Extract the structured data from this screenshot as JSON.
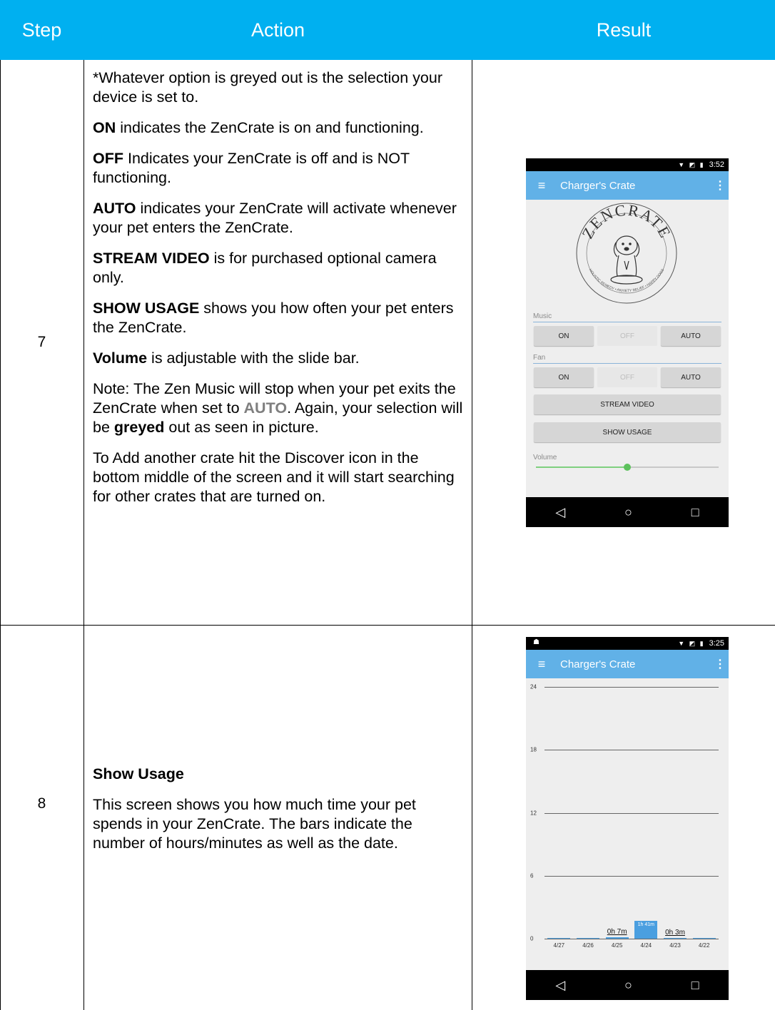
{
  "headers": {
    "step": "Step",
    "action": "Action",
    "result": "Result"
  },
  "row7": {
    "step": "7",
    "intro": "*Whatever option is greyed out is the selection your device is set to.",
    "on_term": "ON",
    "on_text": " indicates the ZenCrate is on and functioning.",
    "off_term": "OFF",
    "off_text": " Indicates your ZenCrate is off and is NOT functioning.",
    "auto_term": "AUTO",
    "auto_text": " indicates your ZenCrate will activate whenever your pet enters the ZenCrate.",
    "stream_term": "STREAM VIDEO",
    "stream_text": " is for purchased optional camera only.",
    "usage_term": "SHOW USAGE",
    "usage_text": " shows you how often your pet enters the ZenCrate.",
    "volume_term": "Volume",
    "volume_text": " is adjustable with the slide bar.",
    "note_a": "Note:  The Zen Music will stop when your pet exits the ZenCrate when set to ",
    "note_auto": "AUTO",
    "note_b": ". Again, your selection will be ",
    "note_greyed": "greyed",
    "note_c": " out as seen in picture.",
    "add_crate": "To Add another crate hit the Discover icon in the bottom middle of the screen and it will start searching for other crates that are turned on."
  },
  "row8": {
    "step": "8",
    "title": "Show Usage",
    "text": "This screen shows you how much time your pet spends in your ZenCrate.  The bars indicate the number of hours/minutes as well as the date."
  },
  "phone1": {
    "time": "3:52",
    "title": "Charger's Crate",
    "logo_text": "ZENCRATE",
    "logo_ring_text": "HOLISTIC REMEDY • ANXIETY RELIEF • HAPPY DOGS",
    "music_label": "Music",
    "fan_label": "Fan",
    "on": "ON",
    "off": "OFF",
    "auto": "AUTO",
    "music_selected": "OFF",
    "fan_selected": "OFF",
    "stream_video": "STREAM VIDEO",
    "show_usage": "SHOW USAGE",
    "volume_label": "Volume",
    "volume_level": 0.5,
    "nav_back": "◁",
    "nav_home": "○",
    "nav_recent": "□"
  },
  "phone2": {
    "time": "3:25",
    "title": "Charger's Crate",
    "nav_back": "◁",
    "nav_home": "○",
    "nav_recent": "□"
  },
  "chart_data": {
    "type": "bar",
    "categories": [
      "4/27",
      "4/26",
      "4/25",
      "4/24",
      "4/23",
      "4/22"
    ],
    "values": [
      0,
      0,
      0.117,
      1.683,
      0.05,
      0
    ],
    "bar_labels": [
      "",
      "",
      "0h 7m",
      "1h 41m",
      "0h 3m",
      ""
    ],
    "y_ticks": [
      "0",
      "6",
      "12",
      "18",
      "24"
    ],
    "ylim": [
      0,
      24
    ],
    "grid": true,
    "colors": {
      "bar": "#4a9fe0"
    }
  },
  "colors": {
    "header": "#00b0f0",
    "appbar": "#61b1e7"
  }
}
